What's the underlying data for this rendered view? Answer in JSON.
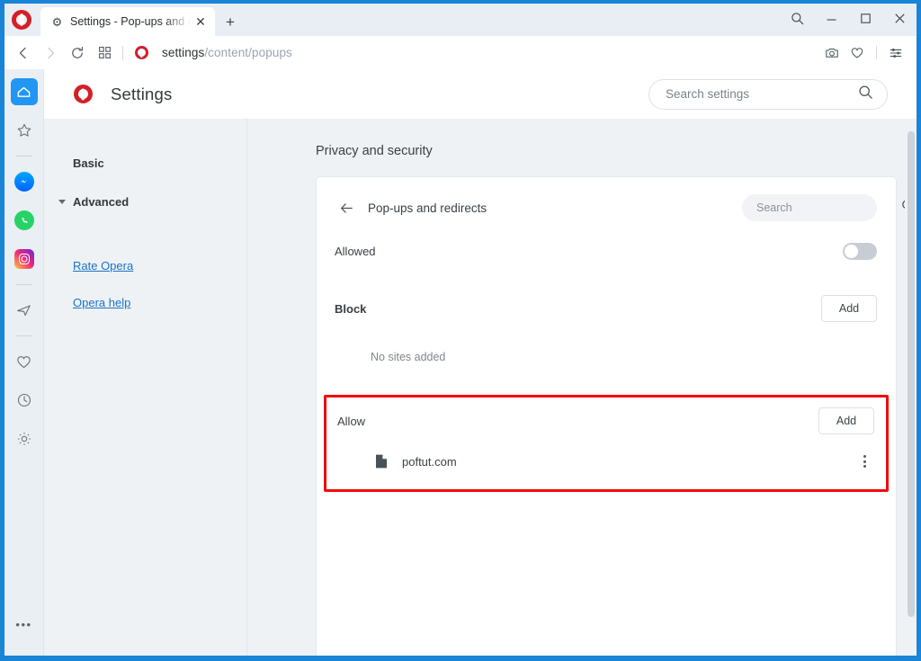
{
  "window": {
    "border_color": "#1a84d6",
    "controls": {
      "search": "search-icon",
      "minimize": "minimize-icon",
      "maximize": "maximize-icon",
      "close": "close-icon"
    }
  },
  "tabbar": {
    "tab": {
      "title": "Settings - Pop-ups and red",
      "favicon": "gear-icon",
      "close": "close-icon"
    },
    "new_tab_label": "+"
  },
  "addressbar": {
    "back": "back-arrow-icon",
    "forward": "forward-arrow-icon",
    "reload": "reload-icon",
    "tiles": "speed-dial-icon",
    "site_icon": "opera-logo-icon",
    "url_bold": "settings",
    "url_rest": "/content/popups",
    "actions": {
      "snapshot": "camera-icon",
      "heart": "heart-icon",
      "easy_setup": "sliders-icon"
    }
  },
  "rail": {
    "items": [
      {
        "name": "home",
        "icon": "home-icon",
        "active": true
      },
      {
        "name": "bookmarks",
        "icon": "star-icon",
        "active": false
      },
      {
        "name": "messenger",
        "icon": "messenger-icon",
        "active": false
      },
      {
        "name": "whatsapp",
        "icon": "whatsapp-icon",
        "active": false
      },
      {
        "name": "instagram",
        "icon": "instagram-icon",
        "active": false
      },
      {
        "name": "telegram",
        "icon": "telegram-icon",
        "active": false
      },
      {
        "name": "favorites",
        "icon": "heart-icon",
        "active": false
      },
      {
        "name": "history",
        "icon": "clock-icon",
        "active": false
      },
      {
        "name": "settings",
        "icon": "gear-icon",
        "active": false
      }
    ],
    "more": "•••"
  },
  "settings_header": {
    "logo": "opera-logo-icon",
    "title": "Settings",
    "search": {
      "placeholder": "Search settings",
      "value": "",
      "icon": "search-icon"
    }
  },
  "settings_nav": {
    "basic": "Basic",
    "advanced": "Advanced",
    "links": [
      {
        "label": "Rate Opera"
      },
      {
        "label": "Opera help"
      }
    ]
  },
  "main": {
    "section_title": "Privacy and security",
    "card": {
      "back_icon": "back-arrow-icon",
      "title": "Pop-ups and redirects",
      "search": {
        "placeholder": "Search",
        "value": "",
        "icon": "search-icon"
      },
      "allowed": {
        "label": "Allowed",
        "toggle_on": false
      },
      "block": {
        "label": "Block",
        "add_label": "Add",
        "empty_text": "No sites added",
        "sites": []
      },
      "allow": {
        "label": "Allow",
        "add_label": "Add",
        "highlighted": true,
        "highlight_color": "#f10c0c",
        "sites": [
          {
            "icon": "document-icon",
            "name": "poftut.com",
            "menu": "kebab-menu-icon"
          }
        ]
      }
    }
  }
}
